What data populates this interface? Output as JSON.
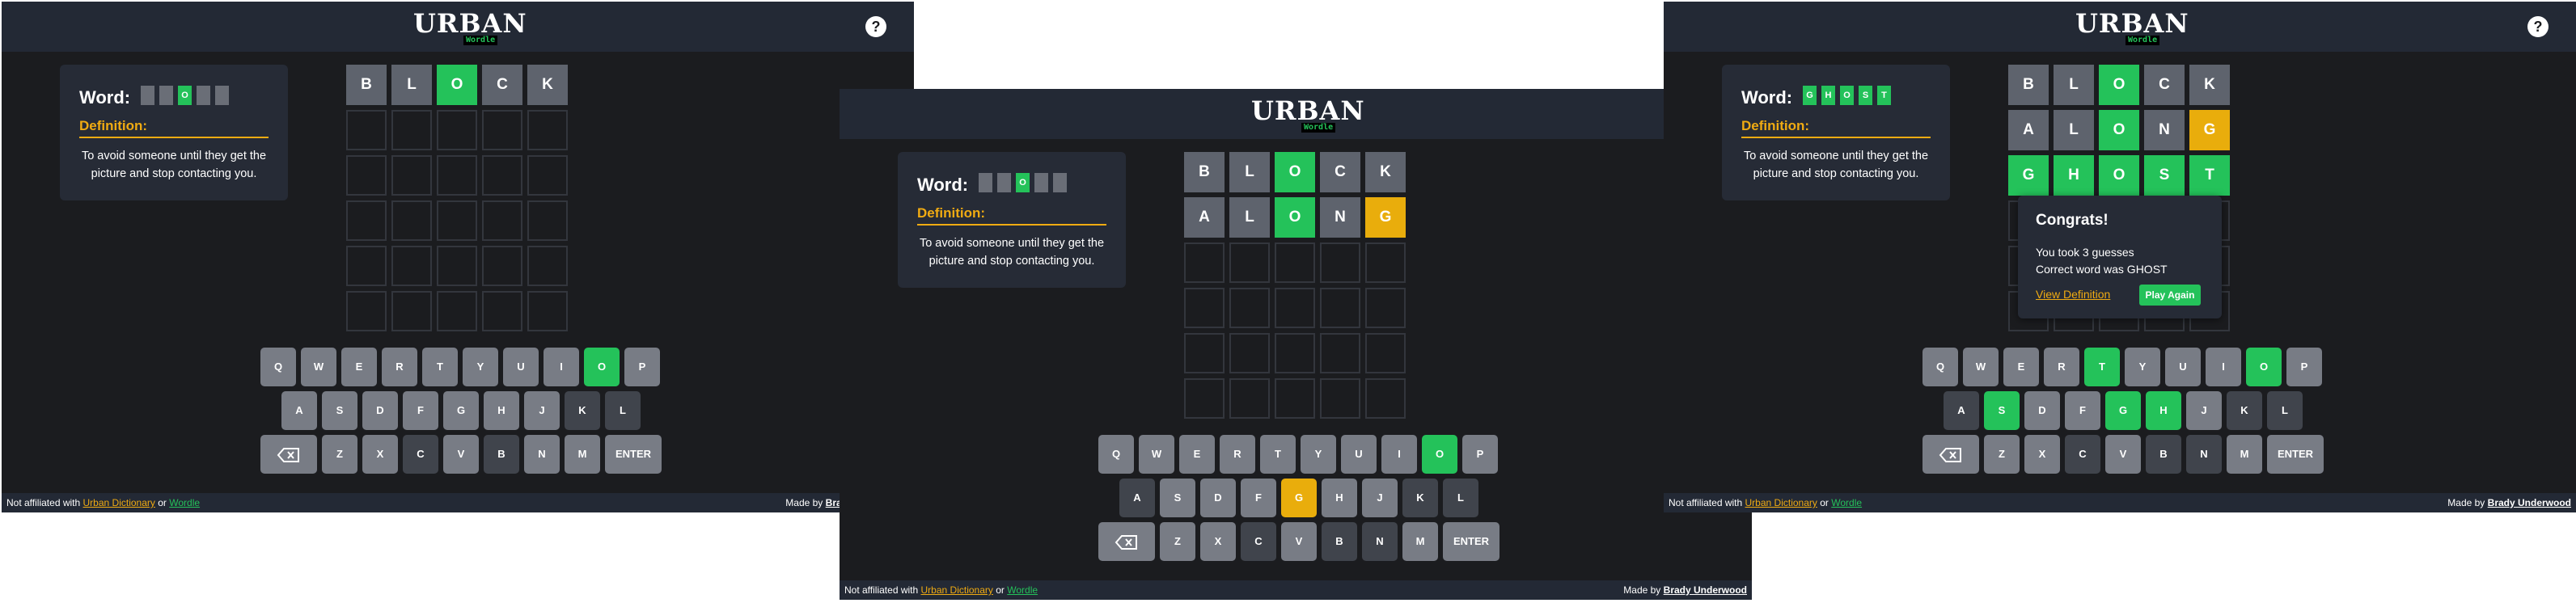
{
  "app": {
    "logo_text": "URBAN",
    "logo_sub": "Wordle",
    "help_label": "?"
  },
  "panel": {
    "word_label": "Word:",
    "definition_label": "Definition:",
    "definition": "To avoid someone until they get the picture and stop contacting you."
  },
  "footer": {
    "prefix": "Not affiliated with",
    "link1": "Urban Dictionary",
    "or": "or",
    "link2": "Wordle",
    "made_by": "Made by",
    "author": "Brady Underwood"
  },
  "modal": {
    "title": "Congrats!",
    "line1": "You took 3 guesses",
    "line2": "Correct word was GHOST",
    "view_definition": "View Definition",
    "play_again": "Play Again"
  },
  "keyboard_rows": [
    [
      "Q",
      "W",
      "E",
      "R",
      "T",
      "Y",
      "U",
      "I",
      "O",
      "P"
    ],
    [
      "A",
      "S",
      "D",
      "F",
      "G",
      "H",
      "J",
      "K",
      "L"
    ],
    [
      "BACKSPACE",
      "Z",
      "X",
      "C",
      "V",
      "B",
      "N",
      "M",
      "ENTER"
    ]
  ],
  "colors": {
    "green": "#24c25a",
    "yellow": "#e9ad0c",
    "orange_text": "#f0ab12",
    "key_gray": "#787c85",
    "key_dark": "#40444c",
    "bg": "#1b1c1f",
    "bar": "#232935"
  },
  "screens": [
    {
      "id": "screen-1",
      "mini_word": [
        {
          "letter": "",
          "state": "blank"
        },
        {
          "letter": "",
          "state": "blank"
        },
        {
          "letter": "O",
          "state": "correct"
        },
        {
          "letter": "",
          "state": "blank"
        },
        {
          "letter": "",
          "state": "blank"
        }
      ],
      "rows": [
        [
          {
            "l": "B",
            "s": "absent"
          },
          {
            "l": "L",
            "s": "absent"
          },
          {
            "l": "O",
            "s": "correct"
          },
          {
            "l": "C",
            "s": "absent"
          },
          {
            "l": "K",
            "s": "absent"
          }
        ]
      ],
      "key_states": {
        "O": "correct",
        "B": "absent",
        "L": "absent",
        "C": "absent",
        "K": "absent"
      },
      "show_modal": false
    },
    {
      "id": "screen-2",
      "mini_word": [
        {
          "letter": "",
          "state": "blank"
        },
        {
          "letter": "",
          "state": "blank"
        },
        {
          "letter": "O",
          "state": "correct"
        },
        {
          "letter": "",
          "state": "blank"
        },
        {
          "letter": "",
          "state": "blank"
        }
      ],
      "rows": [
        [
          {
            "l": "B",
            "s": "absent"
          },
          {
            "l": "L",
            "s": "absent"
          },
          {
            "l": "O",
            "s": "correct"
          },
          {
            "l": "C",
            "s": "absent"
          },
          {
            "l": "K",
            "s": "absent"
          }
        ],
        [
          {
            "l": "A",
            "s": "absent"
          },
          {
            "l": "L",
            "s": "absent"
          },
          {
            "l": "O",
            "s": "correct"
          },
          {
            "l": "N",
            "s": "absent"
          },
          {
            "l": "G",
            "s": "present"
          }
        ]
      ],
      "key_states": {
        "O": "correct",
        "G": "present",
        "B": "absent",
        "L": "absent",
        "C": "absent",
        "K": "absent",
        "A": "absent",
        "N": "absent"
      },
      "show_modal": false
    },
    {
      "id": "screen-3",
      "mini_word": [
        {
          "letter": "G",
          "state": "correct"
        },
        {
          "letter": "H",
          "state": "correct"
        },
        {
          "letter": "O",
          "state": "correct"
        },
        {
          "letter": "S",
          "state": "correct"
        },
        {
          "letter": "T",
          "state": "correct"
        }
      ],
      "rows": [
        [
          {
            "l": "B",
            "s": "absent"
          },
          {
            "l": "L",
            "s": "absent"
          },
          {
            "l": "O",
            "s": "correct"
          },
          {
            "l": "C",
            "s": "absent"
          },
          {
            "l": "K",
            "s": "absent"
          }
        ],
        [
          {
            "l": "A",
            "s": "absent"
          },
          {
            "l": "L",
            "s": "absent"
          },
          {
            "l": "O",
            "s": "correct"
          },
          {
            "l": "N",
            "s": "absent"
          },
          {
            "l": "G",
            "s": "present"
          }
        ],
        [
          {
            "l": "G",
            "s": "correct"
          },
          {
            "l": "H",
            "s": "correct"
          },
          {
            "l": "O",
            "s": "correct"
          },
          {
            "l": "S",
            "s": "correct"
          },
          {
            "l": "T",
            "s": "correct"
          }
        ]
      ],
      "key_states": {
        "O": "correct",
        "G": "correct",
        "H": "correct",
        "S": "correct",
        "T": "correct",
        "B": "absent",
        "L": "absent",
        "C": "absent",
        "K": "absent",
        "A": "absent",
        "N": "absent"
      },
      "show_modal": true
    }
  ]
}
